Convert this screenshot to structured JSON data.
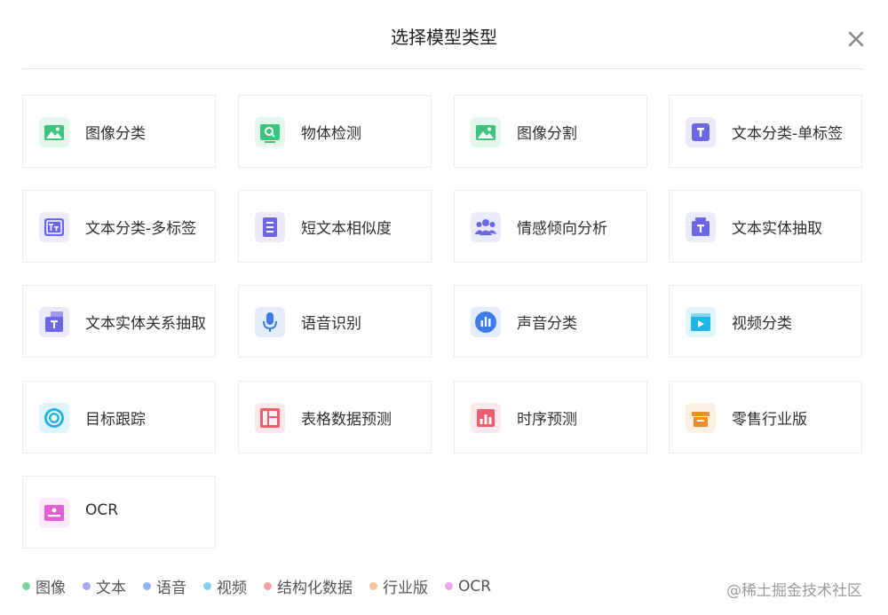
{
  "dialog": {
    "title": "选择模型类型"
  },
  "cards": [
    {
      "label": "图像分类",
      "icon": "image-classification-icon",
      "color": "#3cc47c"
    },
    {
      "label": "物体检测",
      "icon": "object-detection-icon",
      "color": "#3cc47c"
    },
    {
      "label": "图像分割",
      "icon": "image-segmentation-icon",
      "color": "#3cc47c"
    },
    {
      "label": "文本分类-单标签",
      "icon": "text-single-label-icon",
      "color": "#6c67e6"
    },
    {
      "label": "文本分类-多标签",
      "icon": "text-multi-label-icon",
      "color": "#6c67e6"
    },
    {
      "label": "短文本相似度",
      "icon": "short-text-similarity-icon",
      "color": "#6c67e6"
    },
    {
      "label": "情感倾向分析",
      "icon": "sentiment-analysis-icon",
      "color": "#6c67e6"
    },
    {
      "label": "文本实体抽取",
      "icon": "text-entity-extraction-icon",
      "color": "#6c67e6"
    },
    {
      "label": "文本实体关系抽取",
      "icon": "entity-relation-extraction-icon",
      "color": "#6c67e6"
    },
    {
      "label": "语音识别",
      "icon": "microphone-icon",
      "color": "#3d7be8"
    },
    {
      "label": "声音分类",
      "icon": "sound-bars-icon",
      "color": "#3d7be8"
    },
    {
      "label": "视频分类",
      "icon": "video-icon",
      "color": "#1fb5e8"
    },
    {
      "label": "目标跟踪",
      "icon": "target-tracking-icon",
      "color": "#1fb5e8"
    },
    {
      "label": "表格数据预测",
      "icon": "table-grid-icon",
      "color": "#ef5c6e"
    },
    {
      "label": "时序预测",
      "icon": "bar-chart-icon",
      "color": "#ef5c6e"
    },
    {
      "label": "零售行业版",
      "icon": "store-icon",
      "color": "#f28c2f"
    },
    {
      "label": "OCR",
      "icon": "id-card-icon",
      "color": "#e25fd6"
    }
  ],
  "legend": [
    {
      "label": "图像",
      "color": "#7fd4a3"
    },
    {
      "label": "文本",
      "color": "#aaa7ee"
    },
    {
      "label": "语音",
      "color": "#8fb2f0"
    },
    {
      "label": "视频",
      "color": "#86d2f0"
    },
    {
      "label": "结构化数据",
      "color": "#f4a0ab"
    },
    {
      "label": "行业版",
      "color": "#f4c398"
    },
    {
      "label": "OCR",
      "color": "#f0a6ea"
    }
  ],
  "watermark": "@稀土掘金技术社区"
}
